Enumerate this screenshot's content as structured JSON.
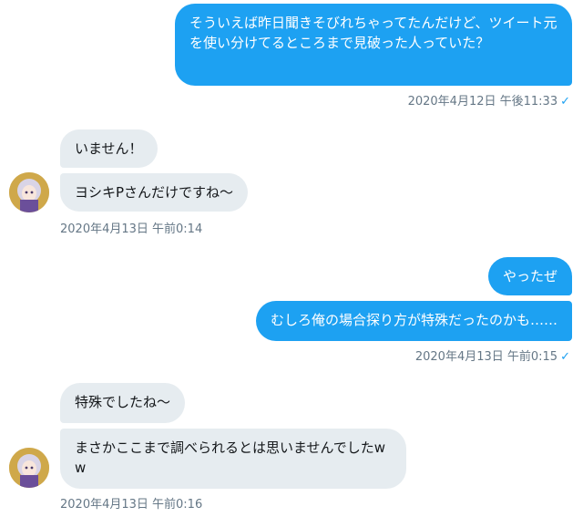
{
  "messages": [
    {
      "direction": "out",
      "text": "そういえば昨日聞きそびれちゃってたんだけど、ツイート元を使い分けてるところまで見破った人っていた？"
    },
    {
      "direction": "in",
      "text": "いません！"
    },
    {
      "direction": "in",
      "text": "ヨシキPさんだけですね〜"
    },
    {
      "direction": "out",
      "text": "やったぜ"
    },
    {
      "direction": "out",
      "text": "むしろ俺の場合探り方が特殊だったのかも……"
    },
    {
      "direction": "in",
      "text": "特殊でしたね〜"
    },
    {
      "direction": "in",
      "text": "まさかここまで調べられるとは思いませんでしたww"
    }
  ],
  "timestamps": {
    "t1": "2020年4月12日 午後11:33",
    "t2": "2020年4月13日 午前0:14",
    "t3": "2020年4月13日 午前0:15",
    "t4": "2020年4月13日 午前0:16"
  },
  "icons": {
    "read_check": "✓",
    "avatar": "avatar-image"
  },
  "colors": {
    "outgoing_bubble": "#1da1f2",
    "incoming_bubble": "#e6ecf0",
    "meta_text": "#657786"
  }
}
